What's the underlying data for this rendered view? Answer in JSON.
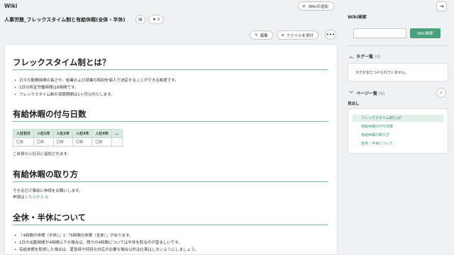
{
  "app": {
    "title": "Wiki"
  },
  "header": {
    "add_wiki_label": "Wikiの追加",
    "page_title": "人事労務_フレックスタイム制と有給休暇(全体・半休)",
    "star_count": "0"
  },
  "toolbar": {
    "edit_label": "編集",
    "attach_label": "ファイルを添付"
  },
  "content": {
    "section1": {
      "heading": "フレックスタイム制とは？",
      "bullets": [
        "日々の勤務時間の長さや、始業および就業の時刻を個人で決定することができる制度です。",
        "1日の所定労働時間は8時間です。",
        "フレックスタイム制の清算期間は1ヶ月以内とします。"
      ]
    },
    "section2": {
      "heading": "有給休暇の付与日数",
      "table": {
        "headers": [
          "入社初日",
          "入社1年",
          "入社2年",
          "入社3年",
          "入社4年",
          "..."
        ],
        "rows": [
          [
            "〇日",
            "〇日",
            "〇日",
            "〇日",
            "〇日",
            ".."
          ]
        ]
      },
      "note": "ご自身の入社日に追加されます。"
    },
    "section3": {
      "heading": "有給休暇の取り方",
      "line1": "できるだけ事前に申請をお願いします。",
      "apply_prefix": "申請は",
      "apply_link": "こちらから"
    },
    "section4": {
      "heading": "全休・半休について",
      "bullets": [
        "「4時間の休暇（半休）」と「8時間の休暇（全休）」があります。",
        "1日の出勤時間が4時間以下の場合は、残りの4時間については半休を取るのが望ましいです。",
        "有給休暇を取得した場合は、緊急時や特別な対応が必要な場合以外は仕事はしないようにしましょう。"
      ]
    }
  },
  "sidebar": {
    "search_heading": "Wiki検索",
    "search_input_value": "",
    "search_button_label": "Wiki検索",
    "tags": {
      "title": "タグ一覧",
      "count": "(0)",
      "empty_text": "タグがまだつけられていません。"
    },
    "pages": {
      "title": "ページ一覧",
      "count": "(6)",
      "subheading": "見出し",
      "items": [
        "フレックスタイム制とは？",
        "有給休暇の付与日数",
        "有給休暇の取り方",
        "全体・半休について"
      ]
    }
  },
  "colors": {
    "accent": "#4aa07a",
    "rule": "#7ab89c",
    "link": "#2e8f68",
    "table_header": "#d9ebe1"
  }
}
